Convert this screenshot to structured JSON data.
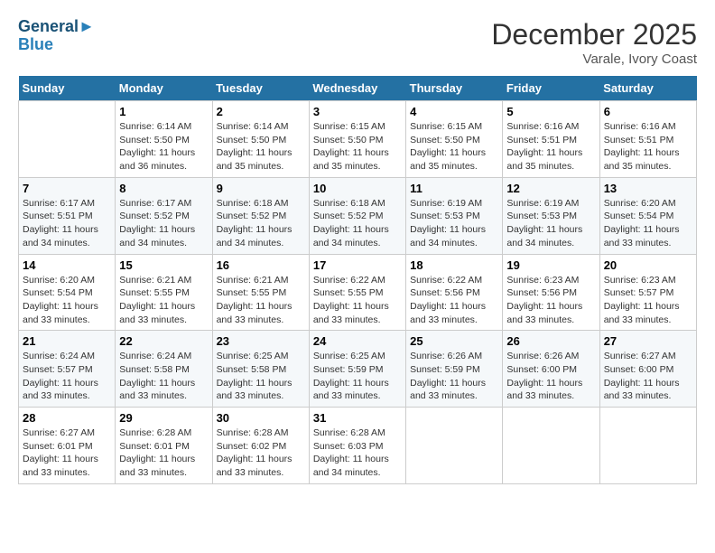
{
  "logo": {
    "line1": "General",
    "line2": "Blue"
  },
  "title": "December 2025",
  "subtitle": "Varale, Ivory Coast",
  "days_header": [
    "Sunday",
    "Monday",
    "Tuesday",
    "Wednesday",
    "Thursday",
    "Friday",
    "Saturday"
  ],
  "weeks": [
    [
      {
        "day": "",
        "sunrise": "",
        "sunset": "",
        "daylight": ""
      },
      {
        "day": "1",
        "sunrise": "Sunrise: 6:14 AM",
        "sunset": "Sunset: 5:50 PM",
        "daylight": "Daylight: 11 hours and 36 minutes."
      },
      {
        "day": "2",
        "sunrise": "Sunrise: 6:14 AM",
        "sunset": "Sunset: 5:50 PM",
        "daylight": "Daylight: 11 hours and 35 minutes."
      },
      {
        "day": "3",
        "sunrise": "Sunrise: 6:15 AM",
        "sunset": "Sunset: 5:50 PM",
        "daylight": "Daylight: 11 hours and 35 minutes."
      },
      {
        "day": "4",
        "sunrise": "Sunrise: 6:15 AM",
        "sunset": "Sunset: 5:50 PM",
        "daylight": "Daylight: 11 hours and 35 minutes."
      },
      {
        "day": "5",
        "sunrise": "Sunrise: 6:16 AM",
        "sunset": "Sunset: 5:51 PM",
        "daylight": "Daylight: 11 hours and 35 minutes."
      },
      {
        "day": "6",
        "sunrise": "Sunrise: 6:16 AM",
        "sunset": "Sunset: 5:51 PM",
        "daylight": "Daylight: 11 hours and 35 minutes."
      }
    ],
    [
      {
        "day": "7",
        "sunrise": "Sunrise: 6:17 AM",
        "sunset": "Sunset: 5:51 PM",
        "daylight": "Daylight: 11 hours and 34 minutes."
      },
      {
        "day": "8",
        "sunrise": "Sunrise: 6:17 AM",
        "sunset": "Sunset: 5:52 PM",
        "daylight": "Daylight: 11 hours and 34 minutes."
      },
      {
        "day": "9",
        "sunrise": "Sunrise: 6:18 AM",
        "sunset": "Sunset: 5:52 PM",
        "daylight": "Daylight: 11 hours and 34 minutes."
      },
      {
        "day": "10",
        "sunrise": "Sunrise: 6:18 AM",
        "sunset": "Sunset: 5:52 PM",
        "daylight": "Daylight: 11 hours and 34 minutes."
      },
      {
        "day": "11",
        "sunrise": "Sunrise: 6:19 AM",
        "sunset": "Sunset: 5:53 PM",
        "daylight": "Daylight: 11 hours and 34 minutes."
      },
      {
        "day": "12",
        "sunrise": "Sunrise: 6:19 AM",
        "sunset": "Sunset: 5:53 PM",
        "daylight": "Daylight: 11 hours and 34 minutes."
      },
      {
        "day": "13",
        "sunrise": "Sunrise: 6:20 AM",
        "sunset": "Sunset: 5:54 PM",
        "daylight": "Daylight: 11 hours and 33 minutes."
      }
    ],
    [
      {
        "day": "14",
        "sunrise": "Sunrise: 6:20 AM",
        "sunset": "Sunset: 5:54 PM",
        "daylight": "Daylight: 11 hours and 33 minutes."
      },
      {
        "day": "15",
        "sunrise": "Sunrise: 6:21 AM",
        "sunset": "Sunset: 5:55 PM",
        "daylight": "Daylight: 11 hours and 33 minutes."
      },
      {
        "day": "16",
        "sunrise": "Sunrise: 6:21 AM",
        "sunset": "Sunset: 5:55 PM",
        "daylight": "Daylight: 11 hours and 33 minutes."
      },
      {
        "day": "17",
        "sunrise": "Sunrise: 6:22 AM",
        "sunset": "Sunset: 5:55 PM",
        "daylight": "Daylight: 11 hours and 33 minutes."
      },
      {
        "day": "18",
        "sunrise": "Sunrise: 6:22 AM",
        "sunset": "Sunset: 5:56 PM",
        "daylight": "Daylight: 11 hours and 33 minutes."
      },
      {
        "day": "19",
        "sunrise": "Sunrise: 6:23 AM",
        "sunset": "Sunset: 5:56 PM",
        "daylight": "Daylight: 11 hours and 33 minutes."
      },
      {
        "day": "20",
        "sunrise": "Sunrise: 6:23 AM",
        "sunset": "Sunset: 5:57 PM",
        "daylight": "Daylight: 11 hours and 33 minutes."
      }
    ],
    [
      {
        "day": "21",
        "sunrise": "Sunrise: 6:24 AM",
        "sunset": "Sunset: 5:57 PM",
        "daylight": "Daylight: 11 hours and 33 minutes."
      },
      {
        "day": "22",
        "sunrise": "Sunrise: 6:24 AM",
        "sunset": "Sunset: 5:58 PM",
        "daylight": "Daylight: 11 hours and 33 minutes."
      },
      {
        "day": "23",
        "sunrise": "Sunrise: 6:25 AM",
        "sunset": "Sunset: 5:58 PM",
        "daylight": "Daylight: 11 hours and 33 minutes."
      },
      {
        "day": "24",
        "sunrise": "Sunrise: 6:25 AM",
        "sunset": "Sunset: 5:59 PM",
        "daylight": "Daylight: 11 hours and 33 minutes."
      },
      {
        "day": "25",
        "sunrise": "Sunrise: 6:26 AM",
        "sunset": "Sunset: 5:59 PM",
        "daylight": "Daylight: 11 hours and 33 minutes."
      },
      {
        "day": "26",
        "sunrise": "Sunrise: 6:26 AM",
        "sunset": "Sunset: 6:00 PM",
        "daylight": "Daylight: 11 hours and 33 minutes."
      },
      {
        "day": "27",
        "sunrise": "Sunrise: 6:27 AM",
        "sunset": "Sunset: 6:00 PM",
        "daylight": "Daylight: 11 hours and 33 minutes."
      }
    ],
    [
      {
        "day": "28",
        "sunrise": "Sunrise: 6:27 AM",
        "sunset": "Sunset: 6:01 PM",
        "daylight": "Daylight: 11 hours and 33 minutes."
      },
      {
        "day": "29",
        "sunrise": "Sunrise: 6:28 AM",
        "sunset": "Sunset: 6:01 PM",
        "daylight": "Daylight: 11 hours and 33 minutes."
      },
      {
        "day": "30",
        "sunrise": "Sunrise: 6:28 AM",
        "sunset": "Sunset: 6:02 PM",
        "daylight": "Daylight: 11 hours and 33 minutes."
      },
      {
        "day": "31",
        "sunrise": "Sunrise: 6:28 AM",
        "sunset": "Sunset: 6:03 PM",
        "daylight": "Daylight: 11 hours and 34 minutes."
      },
      {
        "day": "",
        "sunrise": "",
        "sunset": "",
        "daylight": ""
      },
      {
        "day": "",
        "sunrise": "",
        "sunset": "",
        "daylight": ""
      },
      {
        "day": "",
        "sunrise": "",
        "sunset": "",
        "daylight": ""
      }
    ]
  ]
}
